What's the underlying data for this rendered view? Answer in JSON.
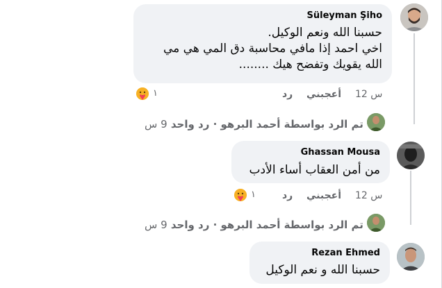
{
  "comments": [
    {
      "author": "Süleyman Şiho",
      "lines": [
        "حسبنا الله ونعم الوكيل.",
        "اخي احمد إذا مافي محاسبة دق المي هي مي",
        "الله يقويك وتفضح هيك ........"
      ],
      "time": "12 س",
      "like_label": "أعجبني",
      "reply_label": "رد",
      "reaction_count": "١",
      "reaction_icon": "care-emoji-icon",
      "replies_summary": "تم الرد بواسطة أحمد البرهو · رد واحد",
      "replies_time": "9 س"
    },
    {
      "author": "Ghassan Mousa",
      "lines": [
        "من أمن العقاب أساء الأدب"
      ],
      "time": "12 س",
      "like_label": "أعجبني",
      "reply_label": "رد",
      "reaction_count": "١",
      "reaction_icon": "care-emoji-icon",
      "replies_summary": "تم الرد بواسطة أحمد البرهو · رد واحد",
      "replies_time": "9 س"
    },
    {
      "author": "Rezan Ehmed",
      "lines": [
        "حسبنا الله و نعم الوكيل"
      ]
    }
  ],
  "colors": {
    "bubble": "#f0f2f5",
    "secondary_text": "#65676b",
    "primary_text": "#050505",
    "reaction": "#f7b125"
  }
}
